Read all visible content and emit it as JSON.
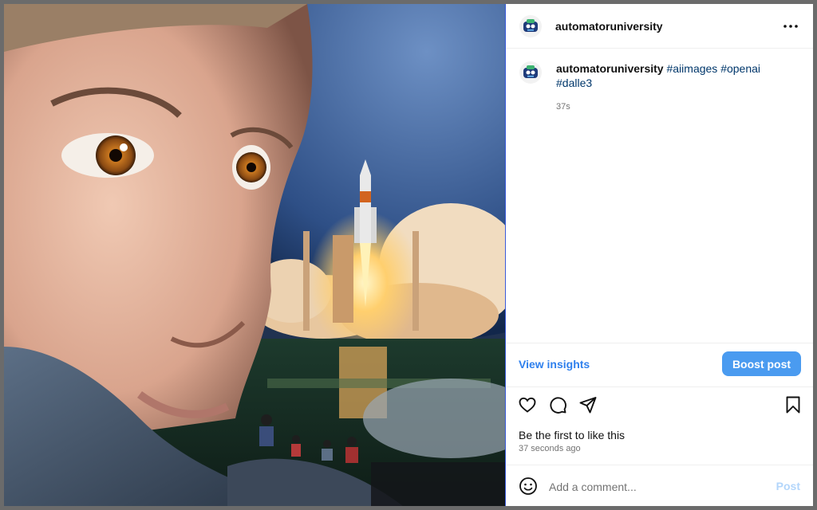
{
  "post": {
    "username": "automatoruniversity",
    "caption": {
      "username": "automatoruniversity",
      "tags": [
        "#aiimages",
        "#openai",
        "#dalle3"
      ],
      "time": "37s"
    },
    "view_insights_label": "View insights",
    "boost_label": "Boost post",
    "likes_text": "Be the first to like this",
    "posted_ago": "37 seconds ago"
  },
  "comment": {
    "placeholder": "Add a comment...",
    "post_label": "Post"
  },
  "icons": {
    "more": "more-options-icon",
    "like": "heart-icon",
    "comment": "comment-icon",
    "share": "share-icon",
    "save": "bookmark-icon",
    "emoji": "emoji-icon"
  },
  "colors": {
    "accent": "#4a9bf0",
    "link": "#2f80ed",
    "hashtag": "#00376b",
    "muted": "#737373"
  }
}
